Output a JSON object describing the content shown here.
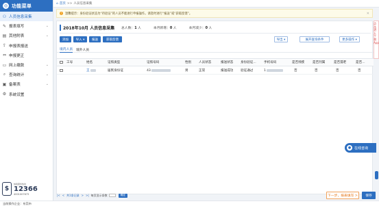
{
  "sidebar": {
    "title": "功能菜单",
    "items": [
      {
        "label": "人员信息采集",
        "icon": "person-icon",
        "active": true
      },
      {
        "label": "报表填写",
        "icon": "edit-icon",
        "arrow": "⌄"
      },
      {
        "label": "其他附表",
        "icon": "table-icon",
        "arrow": "⌄"
      },
      {
        "label": "申报表报送",
        "icon": "send-icon"
      },
      {
        "label": "申报更正",
        "icon": "correct-icon"
      },
      {
        "label": "网上缴款",
        "icon": "payment-icon",
        "arrow": "⌄"
      },
      {
        "label": "查询统计",
        "icon": "query-icon",
        "arrow": "⌄"
      },
      {
        "label": "备案表",
        "icon": "record-icon",
        "arrow": "⌄"
      },
      {
        "label": "系统设置",
        "icon": "settings-icon"
      }
    ],
    "hotline": {
      "sub": "纳税服务热线",
      "number": "12366",
      "tel": "4001007673"
    }
  },
  "breadcrumb": {
    "home": "首页",
    "separator": ">>",
    "current": "人员信息采集"
  },
  "notice": {
    "text": "温馨提示：身份验证状态为“待验证”的人员不能进行申报操作，请及时进行“报送”或“获取反馈”。"
  },
  "panel": {
    "title": "2018年10月 人员信息采集",
    "stats": [
      {
        "label": "总人数：",
        "value": "1",
        "unit": "人"
      },
      {
        "label": "本月新增：",
        "value": "0",
        "unit": "人"
      },
      {
        "label": "本月减少：",
        "value": "0",
        "unit": "人"
      }
    ]
  },
  "toolbar": {
    "add": "添加",
    "import": "导入 ▾",
    "report": "报送",
    "feedback": "获取反馈",
    "export": "导出 ▾",
    "expand_query": "展开查询条件",
    "more": "更多操作 ▾"
  },
  "tabs": [
    {
      "label": "境内人员",
      "active": true
    },
    {
      "label": "境外人员",
      "active": false
    }
  ],
  "grid": {
    "columns": [
      "工号",
      "姓名",
      "证照类型",
      "证照号码",
      "性别",
      "人员状态",
      "报送状态",
      "身份验证...",
      "手机号码",
      "是否残疾",
      "是否烈属",
      "是否孤老",
      "是否..."
    ],
    "rows": [
      {
        "id": "",
        "name": "王",
        "cert_type": "居民身份证",
        "cert_no": "43",
        "gender": "男",
        "status": "正常",
        "report_status": "报送成功",
        "verify": "验证通过",
        "phone": "1",
        "disabled": "否",
        "martyr": "否",
        "elderly": "否",
        "other": "否"
      }
    ]
  },
  "pager": {
    "first": "|<",
    "prev": "<",
    "summary": "共1条记录",
    "per_page": "每页显示条数",
    "page_value": "100",
    "confirm": "确定",
    "next": ">",
    "last": ">|"
  },
  "actions": {
    "next_step": "下一步，报表填写 >",
    "save": "保存"
  },
  "footer": {
    "text": "当前操作企业：东莞市"
  },
  "online_chat": {
    "label": "在线咨询"
  },
  "right_strip": {
    "text": "点击进入个税App"
  },
  "colors": {
    "primary": "#2d6fc1",
    "warn": "#f0a020",
    "next": "#e57a1f"
  }
}
